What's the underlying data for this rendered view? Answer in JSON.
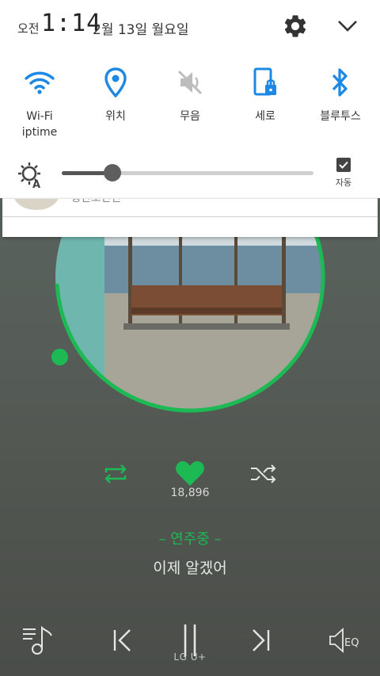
{
  "status_bar": {
    "ampm": "오전",
    "time": "1:14",
    "date": "2월 13일 월요일",
    "settings_icon": "gear-icon",
    "collapse_icon": "chevron-down-icon"
  },
  "quick_settings": [
    {
      "id": "wifi",
      "icon": "wifi-icon",
      "label_line1": "Wi-Fi",
      "label_line2": "iptime",
      "active": true
    },
    {
      "id": "location",
      "icon": "location-pin-icon",
      "label_line1": "위치",
      "active": true
    },
    {
      "id": "mute",
      "icon": "mute-icon",
      "label_line1": "무음",
      "active": false
    },
    {
      "id": "rotation",
      "icon": "rotation-lock-icon",
      "label_line1": "세로",
      "active": true
    },
    {
      "id": "bluetooth",
      "icon": "bluetooth-icon",
      "label_line1": "블루투스",
      "active": true
    }
  ],
  "brightness": {
    "level": 0.2,
    "auto_label": "자동",
    "auto_checked": true
  },
  "notification": {
    "partial_text": "생인노난단"
  },
  "player": {
    "like_count": "18,896",
    "now_playing_label": "– 연주중 –",
    "song_title": "이제 알겠어",
    "carrier": "LG U+",
    "progress": 0.74
  },
  "colors": {
    "accent_blue": "#1e88e5",
    "accent_green": "#1db954",
    "inactive_gray": "#bdbdbd"
  }
}
